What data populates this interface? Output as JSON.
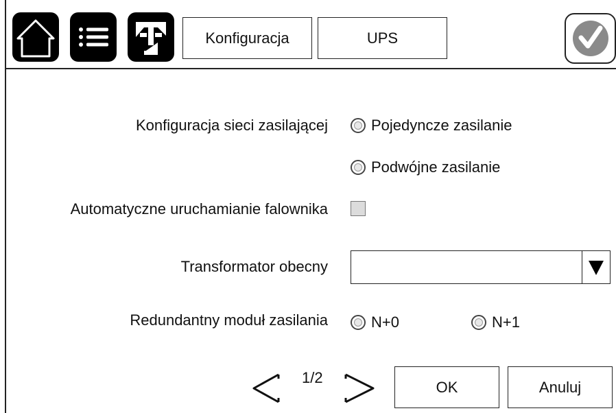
{
  "header": {
    "tabs": [
      {
        "label": "Konfiguracja"
      },
      {
        "label": "UPS"
      }
    ],
    "icons": [
      "home-icon",
      "menu-icon",
      "one-line-diagram-icon",
      "check-icon"
    ]
  },
  "form": {
    "grid_config": {
      "label": "Konfiguracja sieci zasilającej",
      "options": [
        "Pojedyncze zasilanie",
        "Podwójne zasilanie"
      ]
    },
    "auto_start": {
      "label": "Automatyczne uruchamianie falownika",
      "checked": false
    },
    "transformer": {
      "label": "Transformator obecny",
      "value": ""
    },
    "redundancy": {
      "label": "Redundantny moduł zasilania",
      "options": [
        "N+0",
        "N+1"
      ]
    }
  },
  "footer": {
    "page": "1/2",
    "ok_label": "OK",
    "cancel_label": "Anuluj"
  },
  "colors": {
    "icon_bg": "#000000",
    "check_mark": "#8a8a8a",
    "checkbox_fill": "#dcdcdc"
  }
}
